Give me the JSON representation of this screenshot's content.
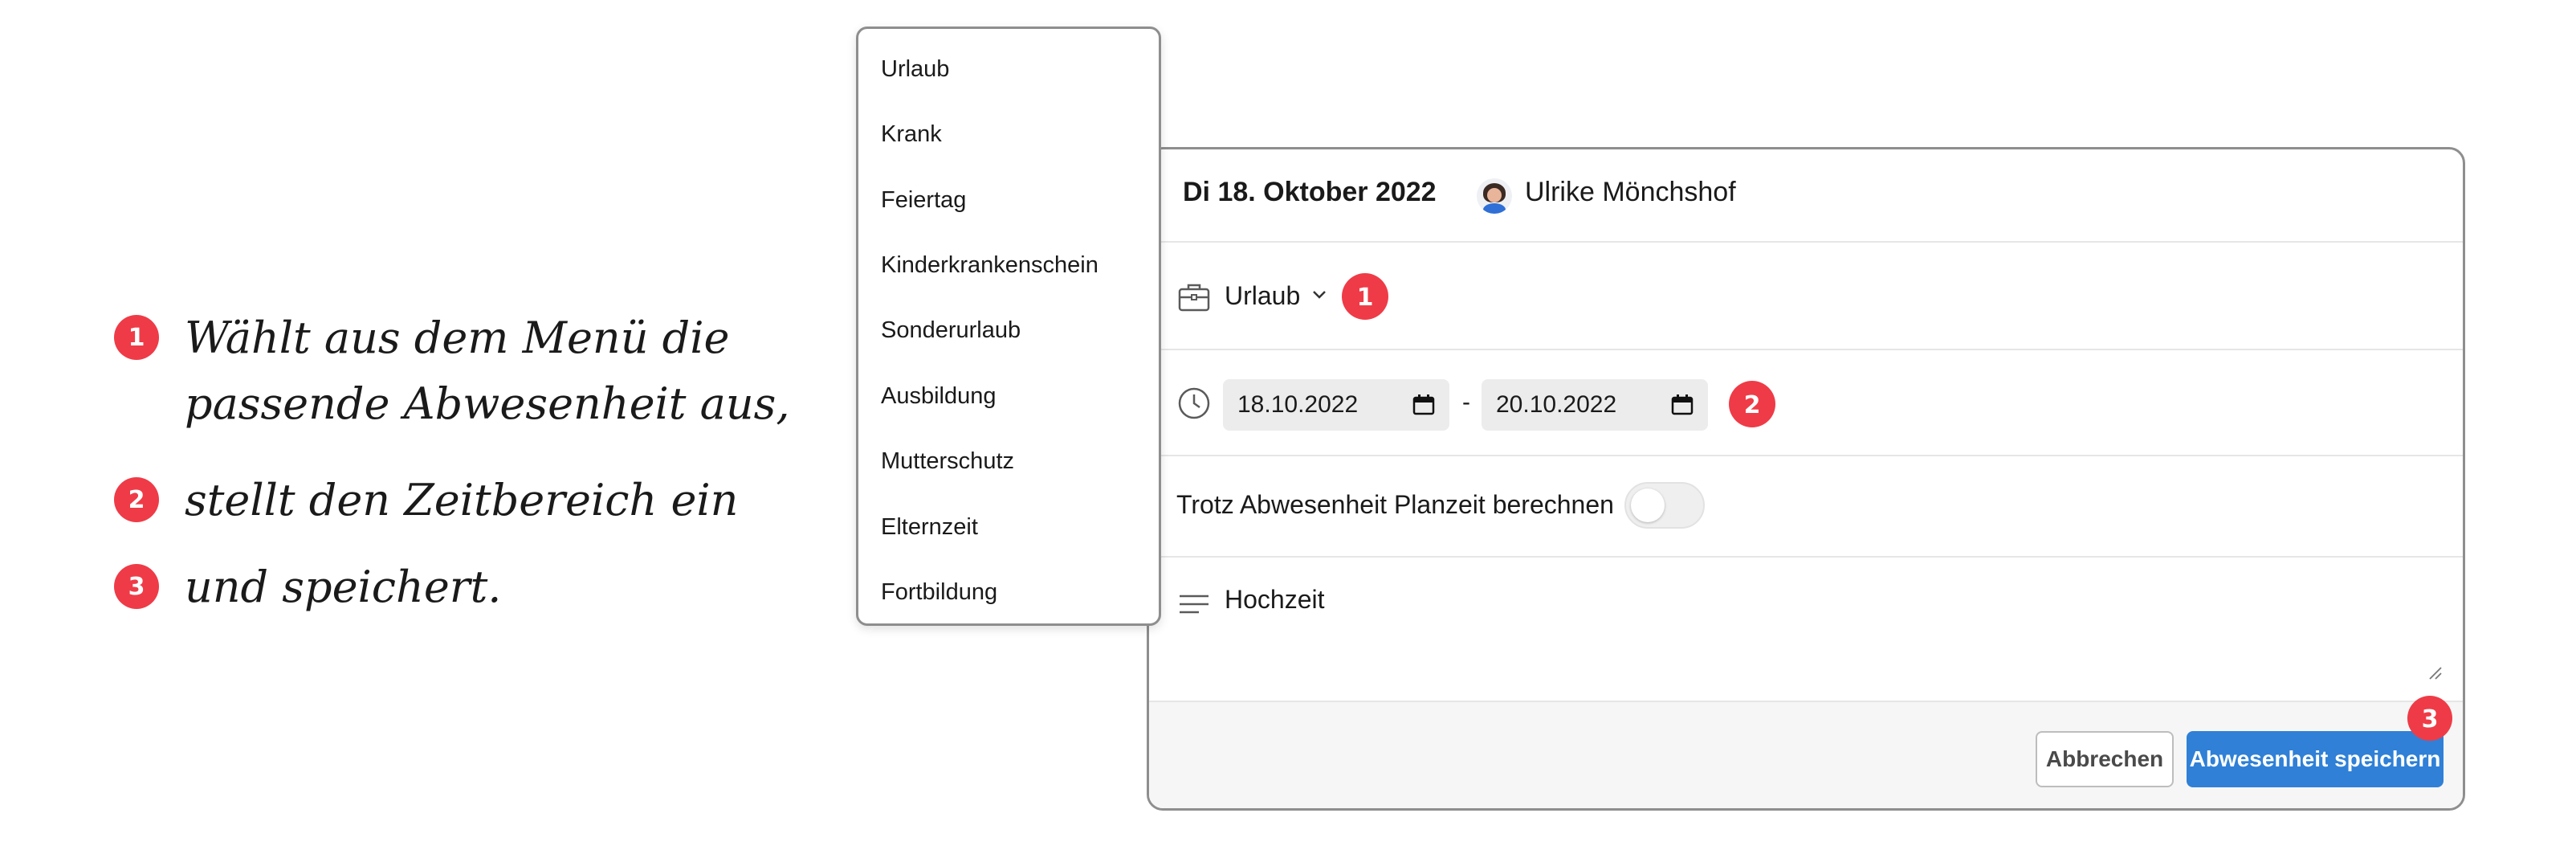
{
  "instructions": [
    {
      "number": "1",
      "text": "Wählt aus dem Menü die passende Abwesenheit aus,"
    },
    {
      "number": "2",
      "text": "stellt den Zeitbereich ein"
    },
    {
      "number": "3",
      "text": "und speichert."
    }
  ],
  "menu": {
    "items": [
      "Urlaub",
      "Krank",
      "Feiertag",
      "Kinderkrankenschein",
      "Sonderurlaub",
      "Ausbildung",
      "Mutterschutz",
      "Elternzeit",
      "Fortbildung"
    ]
  },
  "header": {
    "date": "Di 18. Oktober 2022",
    "user_name": "Ulrike Mönchshof"
  },
  "absence_type": {
    "selected": "Urlaub",
    "badge": "1"
  },
  "date_range": {
    "start": "18.10.2022",
    "separator": "-",
    "end": "20.10.2022",
    "badge": "2"
  },
  "planzeit": {
    "label": "Trotz Abwesenheit Planzeit berechnen",
    "enabled": false
  },
  "note": {
    "value": "Hochzeit"
  },
  "footer": {
    "cancel_label": "Abbrechen",
    "save_label": "Abwesenheit speichern",
    "badge": "3"
  },
  "colors": {
    "accent_badge": "#ef3b47",
    "primary_button": "#2f80d6"
  }
}
